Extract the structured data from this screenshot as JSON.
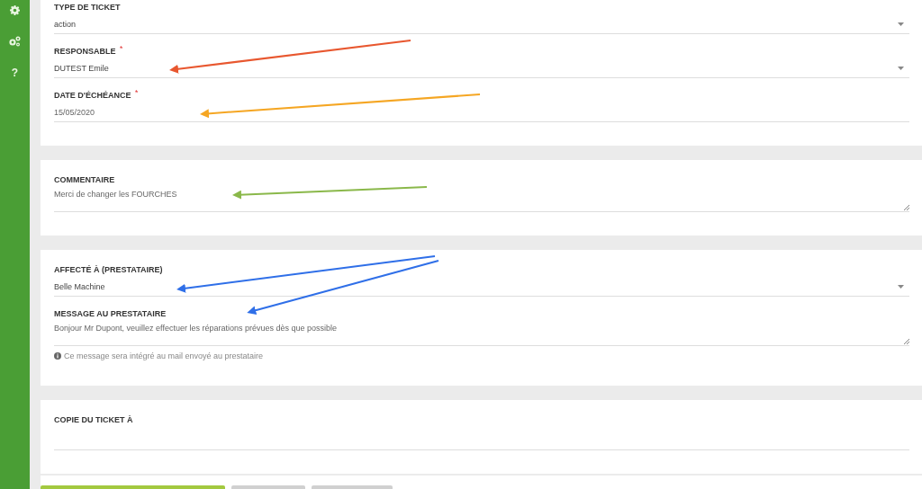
{
  "sidebar": {
    "items": [
      {
        "kind": "gear"
      },
      {
        "kind": "gears"
      },
      {
        "kind": "help",
        "label": "?"
      }
    ]
  },
  "cards": [
    {
      "fields": [
        {
          "label": "TYPE DE TICKET",
          "kind": "select",
          "value": "action"
        },
        {
          "label": "RESPONSABLE",
          "required_mark": "*",
          "kind": "select",
          "value": "DUTEST Emile"
        },
        {
          "label": "DATE D'ÉCHÉANCE",
          "required_mark": "*",
          "kind": "input",
          "value": "15/05/2020"
        }
      ]
    },
    {
      "fields": [
        {
          "label": "COMMENTAIRE",
          "kind": "textarea",
          "value": "Merci de changer les FOURCHES"
        }
      ]
    },
    {
      "fields": [
        {
          "label": "AFFECTÉ À (PRESTATAIRE)",
          "kind": "select",
          "value": "Belle Machine"
        },
        {
          "label": "MESSAGE AU PRESTATAIRE",
          "kind": "textarea",
          "value": "Bonjour Mr Dupont, veuillez effectuer les réparations prévues dès que possible",
          "hint": "Ce message sera intégré au mail envoyé au prestataire"
        }
      ]
    },
    {
      "fields": [
        {
          "label": "COPIE DU TICKET À",
          "kind": "input"
        }
      ]
    }
  ],
  "buttons": [
    {
      "kind": "primary"
    },
    {
      "kind": "secondary"
    },
    {
      "kind": "secondary"
    }
  ],
  "annotations": [
    {
      "color": "#e8572f"
    },
    {
      "color": "#f5a623"
    },
    {
      "color": "#8ab84a"
    },
    {
      "color": "#2f6fe8"
    },
    {
      "color": "#2f6fe8"
    }
  ]
}
